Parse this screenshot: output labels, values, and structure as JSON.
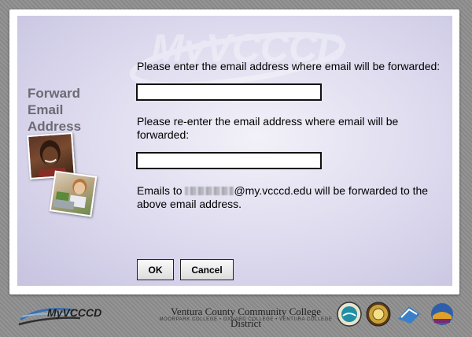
{
  "sidebar": {
    "title_line1": "Forward",
    "title_line2": "Email",
    "title_line3": "Address"
  },
  "form": {
    "label_email": "Please enter the email address where email will be forwarded:",
    "email_value": "",
    "label_confirm": "Please re-enter the email address where email will be forwarded:",
    "confirm_value": "",
    "note_prefix": "Emails to",
    "note_domain": "@my.vcccd.edu will be forwarded to the above email address."
  },
  "buttons": {
    "ok": "OK",
    "cancel": "Cancel"
  },
  "watermark": {
    "text": "MyVCCCD"
  },
  "footer": {
    "logo_text": "MyVCCCD",
    "district": "Ventura County Community College District",
    "colleges": "MOORPARK COLLEGE • OXNARD COLLEGE • VENTURA COLLEGE",
    "seals": [
      "district-seal",
      "moorpark-college-seal",
      "oxnard-college-logo",
      "ventura-college-logo"
    ]
  },
  "colors": {
    "panel": "#dcd9ee",
    "page_background": "#8f8f8f",
    "title_gray": "#6b6b73"
  }
}
